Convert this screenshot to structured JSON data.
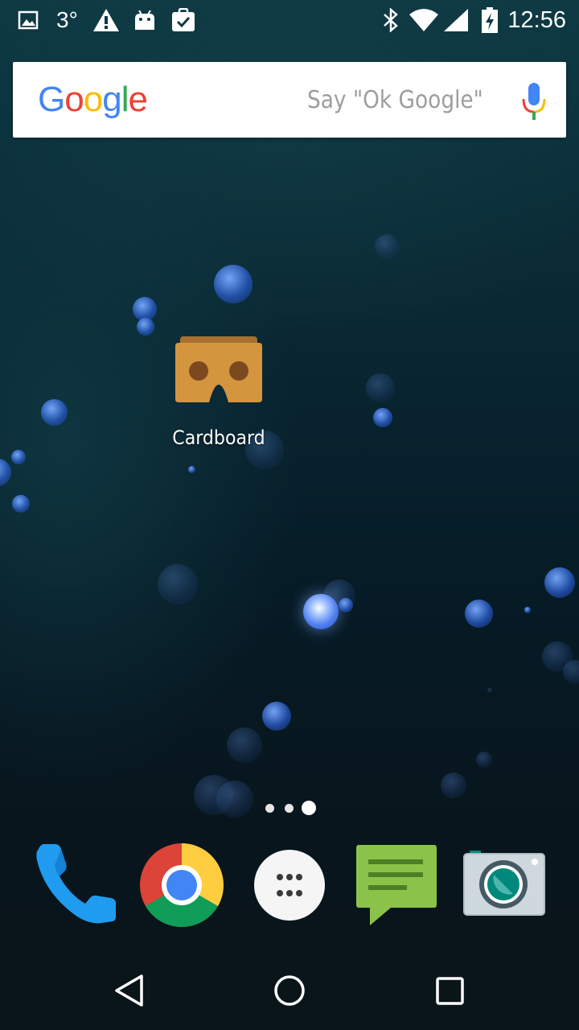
{
  "status_bar": {
    "temperature": "3°",
    "time": "12:56",
    "left_icons": [
      "gallery-icon",
      "warning-icon",
      "android-icon",
      "clipboard-check-icon"
    ],
    "right_icons": [
      "bluetooth-icon",
      "wifi-icon",
      "cell-signal-icon",
      "battery-charging-icon"
    ]
  },
  "search": {
    "logo": [
      "G",
      "o",
      "o",
      "g",
      "l",
      "e"
    ],
    "logo_colors": [
      "#4285F4",
      "#EA4335",
      "#FBBC05",
      "#4285F4",
      "#34A853",
      "#EA4335"
    ],
    "hint": "Say \"Ok Google\"",
    "mic_icon": "mic-icon"
  },
  "home": {
    "apps": [
      {
        "label": "Cardboard",
        "icon": "cardboard-icon"
      }
    ]
  },
  "page_indicator": {
    "pages": 3,
    "current_page": 3
  },
  "dock": {
    "items": [
      {
        "icon": "phone-icon"
      },
      {
        "icon": "chrome-icon"
      },
      {
        "icon": "app-drawer-icon"
      },
      {
        "icon": "messenger-icon"
      },
      {
        "icon": "camera-icon"
      }
    ]
  },
  "nav_bar": {
    "buttons": [
      "back-icon",
      "home-icon",
      "recents-icon"
    ]
  }
}
